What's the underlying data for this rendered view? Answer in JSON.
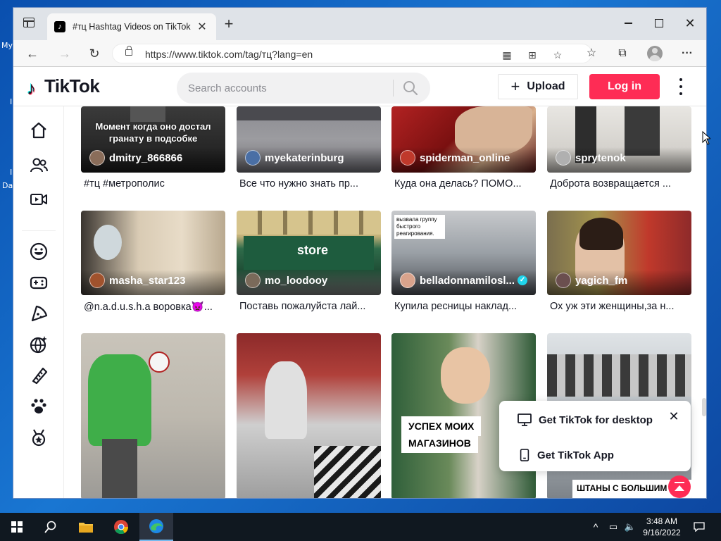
{
  "desktop": {
    "labels": [
      "My",
      "I",
      "Da"
    ]
  },
  "browser": {
    "tab_title": "#тц Hashtag Videos on TikTok",
    "url": "https://www.tiktok.com/tag/тц?lang=en",
    "window_controls": [
      "minimize-icon",
      "maximize-icon",
      "close-icon"
    ]
  },
  "tiktok": {
    "logo": "TikTok",
    "search_placeholder": "Search accounts",
    "upload_label": "Upload",
    "login_label": "Log in",
    "sidebar_icons": [
      "home-icon",
      "following-icon",
      "live-icon",
      "comedy-icon",
      "gaming-icon",
      "food-icon",
      "science-icon",
      "beauty-icon",
      "animals-icon",
      "sports-icon"
    ],
    "videos": [
      {
        "author": "dmitry_866866",
        "caption": "#тц #метрополис",
        "overlay": "Момент когда оно достал гранату в подсобке",
        "avatar_color": "#8a6d5a"
      },
      {
        "author": "myekaterinburg",
        "caption": "Все что нужно знать пр...",
        "avatar_color": "#4a6fa5"
      },
      {
        "author": "spiderman_online",
        "caption": "Куда она делась? ПОМО...",
        "avatar_color": "#c0392b"
      },
      {
        "author": "sprytenok",
        "caption": "Доброта возвращается ...",
        "avatar_color": "#b0b0b0"
      },
      {
        "author": "masha_star123",
        "caption": "@n.a.d.u.s.h.a воровка👿...",
        "avatar_color": "#a0522d"
      },
      {
        "author": "mo_loodooy",
        "caption": "Поставь пожалуйста лай...",
        "avatar_color": "#7a6a5a"
      },
      {
        "author": "belladonnamilosl...",
        "caption": "Купила ресницы наклад...",
        "verified": true,
        "overlay": "вызвала группу быстрого реагирования.",
        "avatar_color": "#d9a38c"
      },
      {
        "author": "yagich_fm",
        "caption": "Ох уж эти женщины,за н...",
        "avatar_color": "#6b4f4f"
      },
      {
        "author": "",
        "caption": ""
      },
      {
        "author": "",
        "caption": ""
      },
      {
        "author": "",
        "caption": "",
        "overlay_line1": "УСПЕХ МОИХ",
        "overlay_line2": "МАГАЗИНОВ"
      },
      {
        "author": "",
        "caption": "",
        "overlay": "ШТАНЫ С БОЛЬШИМ СЮРПРИЗОМ"
      }
    ],
    "store_sign": "store",
    "popup": {
      "desktop_label": "Get TikTok for desktop",
      "app_label": "Get TikTok App"
    }
  },
  "taskbar": {
    "time": "3:48 AM",
    "date": "9/16/2022",
    "items": [
      "windows-start-icon",
      "search-icon",
      "file-explorer-icon",
      "chrome-icon",
      "edge-icon"
    ]
  },
  "colors": {
    "accent": "#fe2c55",
    "verified": "#20d5ec",
    "taskbar": "#101820"
  }
}
